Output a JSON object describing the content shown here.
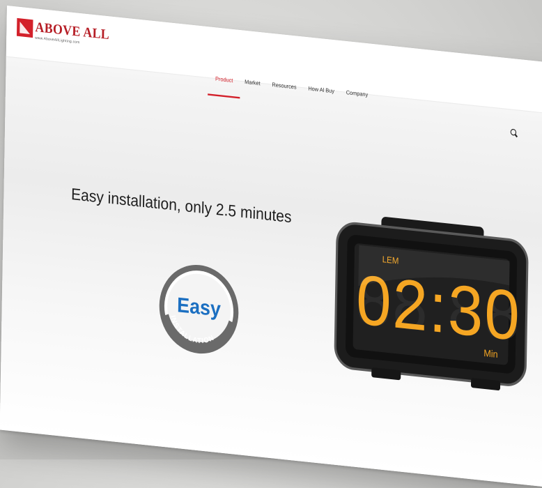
{
  "brand": {
    "name": "ABOVE ALL",
    "url": "www.AboveAllLighting.com",
    "color": "#d3202a"
  },
  "nav": {
    "items": [
      {
        "label": "Product",
        "active": true
      },
      {
        "label": "Market",
        "active": false
      },
      {
        "label": "Resources",
        "active": false
      },
      {
        "label": "How Al Buy",
        "active": false
      },
      {
        "label": "Company",
        "active": false
      }
    ]
  },
  "search": {
    "icon": "search-icon"
  },
  "hero": {
    "headline": "Easy installation, only 2.5 minutes",
    "badge": {
      "word": "Easy",
      "ring_text": "INSTALLATION"
    },
    "timer": {
      "mode": "LEM",
      "time": "02:30",
      "unit": "Min",
      "digit_color": "#f5a623"
    }
  }
}
